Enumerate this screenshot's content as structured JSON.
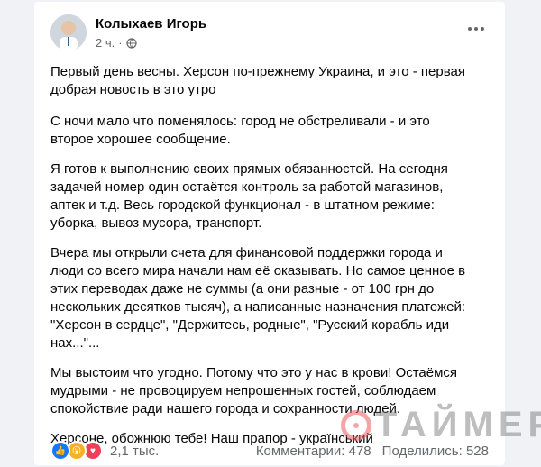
{
  "post": {
    "author": "Колыхаев Игорь",
    "time": "2 ч.",
    "paragraphs": [
      "Первый день весны. Херсон по-прежнему Украина,  и это - первая\nдобрая новость в это утро",
      "С ночи мало что поменялось: город не обстреливали - и это\nвторое хорошее сообщение.",
      "Я готов к выполнению своих прямых обязанностей. На сегодня\nзадачей номер один остаётся контроль за работой магазинов,\nаптек и т.д. Весь городской функционал - в штатном режиме:\nуборка, вывоз мусора, транспорт.",
      "Вчера мы открыли счета для финансовой поддержки города и\nлюди со всего мира начали нам её оказывать. Но самое ценное в\nэтих переводах даже не суммы (а они разные - от 100 грн до\nнескольких десятков тысяч), а написанные назначения платежей:\n\"Херсон в сердце\", \"Держитесь, родные\", \"Русский корабль иди\nнах...\"...",
      "Мы выстоим что угодно. Потому что это у нас в крови! Остаёмся\nмудрыми - не провоцируем непрошенных гостей, соблюдаем\nспокойствие ради нашего города и сохранности людей.",
      "Херсоне, обожнюю тебе! Наш прапор - український"
    ]
  },
  "footer": {
    "reactions_count": "2,1 тыс.",
    "comments": "Комментарии: 478",
    "shares": "Поделились: 528"
  },
  "watermark": "ТАЙМЕР",
  "colors": {
    "flag_blue": "#0057b7",
    "flag_yellow": "#ffd700",
    "like_blue": "#1877f2"
  },
  "icons": [
    "globe-icon",
    "more-options-icon",
    "like-reaction-icon",
    "wow-reaction-icon",
    "love-reaction-icon",
    "ukraine-flag-emoji"
  ]
}
